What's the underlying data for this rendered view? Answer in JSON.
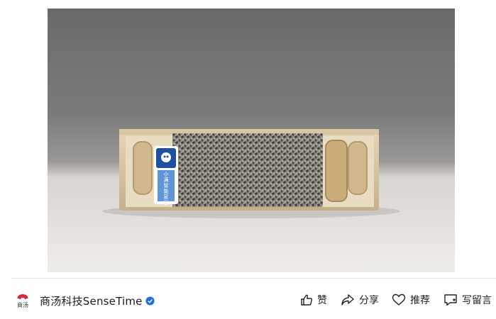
{
  "photo": {
    "subject": "product-photo",
    "badge_text": "小满智能家居"
  },
  "author": {
    "name": "商汤科技SenseTime",
    "logo_text": "商汤",
    "verified": true
  },
  "actions": {
    "like_label": "赞",
    "share_label": "分享",
    "recommend_label": "推荐",
    "comment_label": "写留言"
  },
  "colors": {
    "accent_verified": "#1e6fd9",
    "logo_red": "#d9232b"
  }
}
